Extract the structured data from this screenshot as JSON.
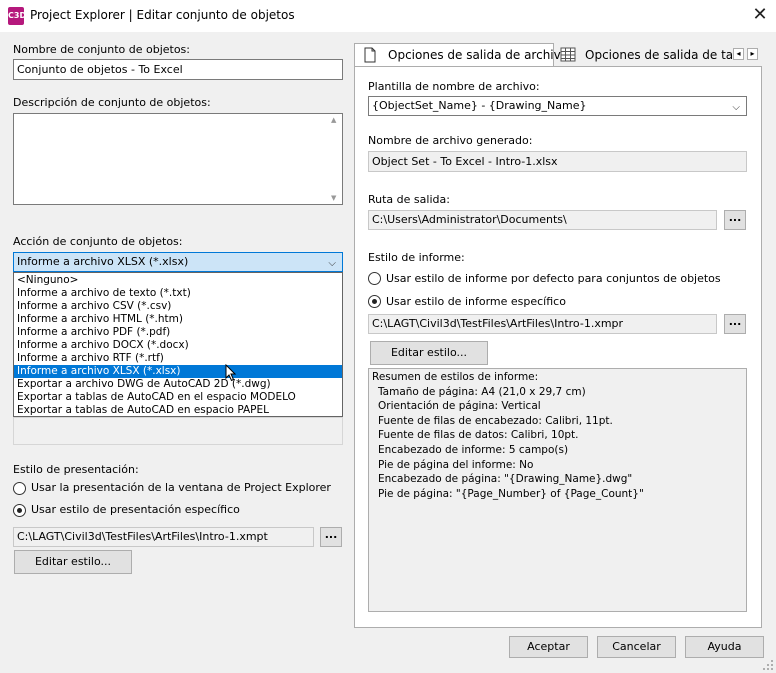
{
  "window": {
    "app_icon_text": "C\n3D",
    "title": "Project Explorer | Editar conjunto de objetos",
    "close": "✕"
  },
  "left": {
    "name_label": "Nombre de conjunto de objetos:",
    "name_value": "Conjunto de objetos - To Excel",
    "desc_label": "Descripción de conjunto de objetos:",
    "desc_value": "",
    "action_label": "Acción de conjunto de objetos:",
    "action_selected": "Informe a archivo XLSX (*.xlsx)",
    "action_options": [
      "<Ninguno>",
      "Informe a archivo de texto (*.txt)",
      "Informe a archivo CSV (*.csv)",
      "Informe a archivo HTML (*.htm)",
      "Informe a archivo PDF (*.pdf)",
      "Informe a archivo DOCX (*.docx)",
      "Informe a archivo RTF (*.rtf)",
      "Informe a archivo XLSX (*.xlsx)",
      "Exportar a archivo DWG de AutoCAD 2D (*.dwg)",
      "Exportar a tablas de AutoCAD en el espacio MODELO",
      "Exportar a tablas de AutoCAD en espacio PAPEL"
    ],
    "presentation_label": "Estilo de presentación:",
    "radio_window": "Usar la presentación de la ventana de Project Explorer",
    "radio_specific": "Usar estilo de presentación específico",
    "style_path": "C:\\LAGT\\Civil3d\\TestFiles\\ArtFiles\\Intro-1.xmpt",
    "browse": "...",
    "edit_style": "Editar estilo..."
  },
  "tabs": {
    "tab1": "Opciones de salida de archivo",
    "tab2": "Opciones de salida de tabla",
    "scroll_left": "◂",
    "scroll_right": "▸"
  },
  "right": {
    "template_label": "Plantilla de nombre de archivo:",
    "template_value": "{ObjectSet_Name} - {Drawing_Name}",
    "generated_label": "Nombre de archivo generado:",
    "generated_value": "Object Set - To Excel - Intro-1.xlsx",
    "output_label": "Ruta de salida:",
    "output_value": "C:\\Users\\Administrator\\Documents\\",
    "browse": "...",
    "report_style_label": "Estilo de informe:",
    "radio_default": "Usar estilo de informe por defecto para conjuntos de objetos",
    "radio_specific": "Usar estilo de informe específico",
    "report_path": "C:\\LAGT\\Civil3d\\TestFiles\\ArtFiles\\Intro-1.xmpr",
    "edit_style": "Editar estilo...",
    "summary_lines": [
      "Resumen de estilos de informe:",
      "Tamaño de página: A4 (21,0 x 29,7 cm)",
      "Orientación de página: Vertical",
      "Fuente de filas de encabezado: Calibri, 11pt.",
      "Fuente de filas de datos: Calibri, 10pt.",
      "Encabezado de informe: 5 campo(s)",
      "Pie de página del informe: No",
      "Encabezado de página: \"{Drawing_Name}.dwg\"",
      "Pie de página: \"{Page_Number} of {Page_Count}\""
    ]
  },
  "footer": {
    "accept": "Aceptar",
    "cancel": "Cancelar",
    "help": "Ayuda"
  }
}
